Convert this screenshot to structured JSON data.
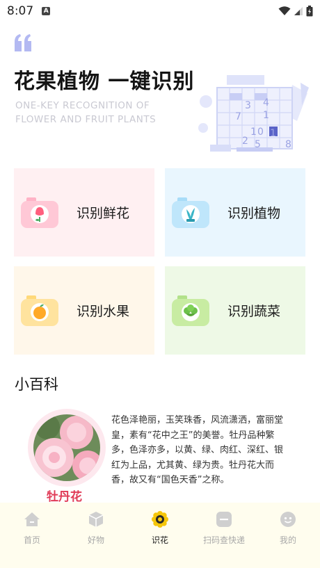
{
  "status_bar": {
    "time": "8:07",
    "notification_glyph": "A"
  },
  "header": {
    "title": "花果植物 一键识别",
    "subtitle": "ONE-KEY RECOGNITION OF\nFLOWER AND FRUIT PLANTS",
    "accent_color": "#b3b9f2",
    "illustration_digits": [
      "3",
      "4",
      "7",
      "1",
      "1",
      "0",
      "2",
      "5",
      "1",
      "8"
    ]
  },
  "categories": [
    {
      "label": "识别鲜花",
      "icon": "flower-camera-icon",
      "color": "#ffc8d6"
    },
    {
      "label": "识别植物",
      "icon": "plant-camera-icon",
      "color": "#bfe6fb"
    },
    {
      "label": "识别水果",
      "icon": "fruit-camera-icon",
      "color": "#ffe39e"
    },
    {
      "label": "识别蔬菜",
      "icon": "vegetable-camera-icon",
      "color": "#c8eca2"
    }
  ],
  "encyclopedia": {
    "title": "小百科",
    "item_name": "牡丹花",
    "item_name_color": "#e03b57",
    "description": "花色泽艳丽，玉笑珠香，风流潇洒，富丽堂皇，素有“花中之王”的美誉。牡丹品种繁多，色泽亦多，以黄、绿、肉红、深红、银红为上品，尤其黄、绿为贵。牡丹花大而香，故又有“国色天香”之称。"
  },
  "tabs": [
    {
      "label": "首页",
      "icon": "home-icon",
      "active": false
    },
    {
      "label": "好物",
      "icon": "cube-icon",
      "active": false
    },
    {
      "label": "识花",
      "icon": "flower-icon",
      "active": true
    },
    {
      "label": "扫码查快递",
      "icon": "scan-icon",
      "active": false
    },
    {
      "label": "我的",
      "icon": "profile-icon",
      "active": false
    }
  ]
}
